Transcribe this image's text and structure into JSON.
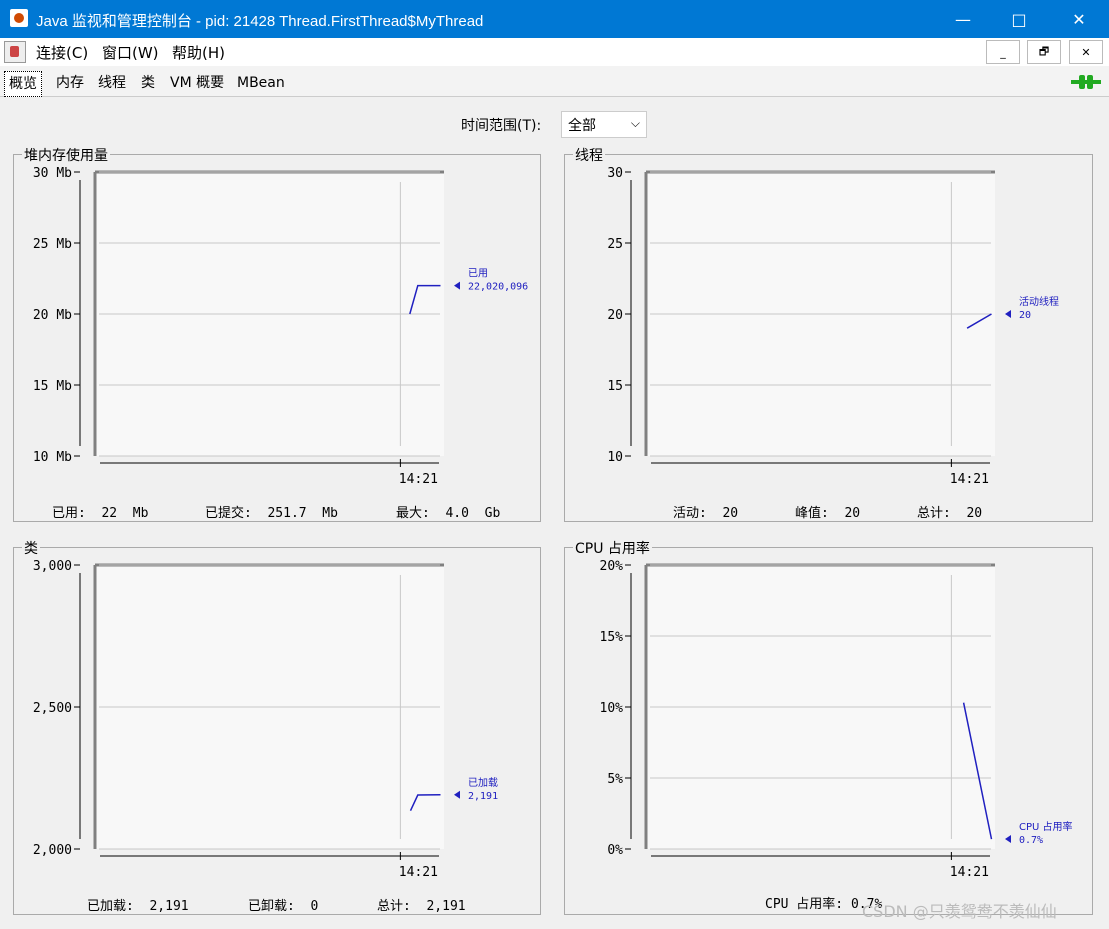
{
  "window": {
    "title": "Java 监视和管理控制台 - pid: 21428 Thread.FirstThread$MyThread",
    "minimize": "—",
    "maximize": "□",
    "close": "✕"
  },
  "menu": {
    "items": [
      "连接(C)",
      "窗口(W)",
      "帮助(H)"
    ],
    "mdi": [
      "_",
      "🗗",
      "✕"
    ]
  },
  "tabs": [
    "概览",
    "内存",
    "线程",
    "类",
    "VM 概要",
    "MBean"
  ],
  "time_range": {
    "label": "时间范围(T):",
    "value": "全部",
    "caret": "⌵"
  },
  "panels": {
    "heap": {
      "title": "堆内存使用量",
      "x_tick": "14:21",
      "y_ticks": [
        "30 Mb",
        "25 Mb",
        "20 Mb",
        "15 Mb",
        "10 Mb"
      ],
      "legend_name": "已用",
      "legend_value": "22,020,096",
      "stats": [
        "已用:  22  Mb",
        "已提交:  251.7  Mb",
        "最大:  4.0  Gb"
      ]
    },
    "threads": {
      "title": "线程",
      "x_tick": "14:21",
      "y_ticks": [
        "30",
        "25",
        "20",
        "15",
        "10"
      ],
      "legend_name": "活动线程",
      "legend_value": "20",
      "stats": [
        "活动:  20",
        "峰值:  20",
        "总计:  20"
      ]
    },
    "classes": {
      "title": "类",
      "x_tick": "14:21",
      "y_ticks": [
        "3,000",
        "2,500",
        "2,000"
      ],
      "legend_name": "已加载",
      "legend_value": "2,191",
      "stats": [
        "已加载:  2,191",
        "已卸载:  0",
        "总计:  2,191"
      ]
    },
    "cpu": {
      "title": "CPU 占用率",
      "x_tick": "14:21",
      "y_ticks": [
        "20%",
        "15%",
        "10%",
        "5%",
        "0%"
      ],
      "legend_name": "CPU 占用率",
      "legend_value": "0.7%",
      "stats": [
        "CPU 占用率: 0.7%"
      ]
    }
  },
  "chart_data": [
    {
      "type": "line",
      "title": "堆内存使用量",
      "ylabel": "Mb",
      "ylim": [
        10,
        30
      ],
      "x": [
        "14:21"
      ],
      "series": [
        {
          "name": "已用",
          "values": [
            20,
            22,
            22
          ]
        }
      ]
    },
    {
      "type": "line",
      "title": "线程",
      "ylim": [
        10,
        30
      ],
      "x": [
        "14:21"
      ],
      "series": [
        {
          "name": "活动线程",
          "values": [
            19,
            20
          ]
        }
      ]
    },
    {
      "type": "line",
      "title": "类",
      "ylim": [
        2000,
        3000
      ],
      "x": [
        "14:21"
      ],
      "series": [
        {
          "name": "已加载",
          "values": [
            2135,
            2190,
            2191
          ]
        }
      ]
    },
    {
      "type": "line",
      "title": "CPU 占用率",
      "ylabel": "%",
      "ylim": [
        0,
        20
      ],
      "x": [
        "14:21"
      ],
      "series": [
        {
          "name": "CPU 占用率",
          "values": [
            10.3,
            0.7
          ]
        }
      ]
    }
  ],
  "watermark": "CSDN @只羡鸳鸯不羡仙仙"
}
